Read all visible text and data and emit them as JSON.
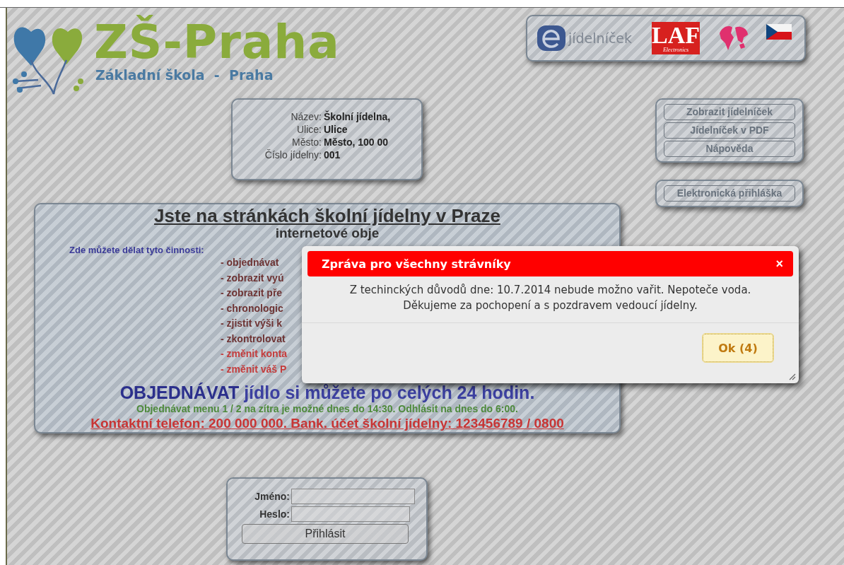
{
  "logo": {
    "title": "ZŠ-Praha",
    "subtitle": "Základní škola  -  Praha"
  },
  "partners": {
    "ejidelnicek": "jídelníček",
    "laf": "LAF",
    "laf_sub": "Electronics"
  },
  "canteen_info": [
    {
      "label": "Název:",
      "value": "Školní jídelna,"
    },
    {
      "label": "Ulice:",
      "value": "Ulice"
    },
    {
      "label": "Město:",
      "value": "Město, 100 00"
    },
    {
      "label": "Číslo jídelny:",
      "value": "001"
    }
  ],
  "menu_buttons": [
    "Zobrazit jídelníček",
    "Jídelníček v PDF",
    "Nápověda"
  ],
  "registration_button": "Elektronická přihláška",
  "welcome": {
    "title": "Jste na stránkách školní jídelny v Praze",
    "subtitle": "internetové obje",
    "intro": "Zde můžete dělat tyto činnosti:",
    "activities": [
      {
        "text": "- objednávat",
        "color": "#6e3434"
      },
      {
        "text": "- zobrazit vyú",
        "color": "#6e3434"
      },
      {
        "text": "- zobrazit pře",
        "color": "#6e3434"
      },
      {
        "text": "- chronologic",
        "color": "#6e3434"
      },
      {
        "text": "- zjistit výši k",
        "color": "#6e3434"
      },
      {
        "text": "- zkontrolovat",
        "color": "#6e3434"
      },
      {
        "text": "- změnit konta",
        "color": "#c43c3c"
      },
      {
        "text": "- změnit váš P",
        "color": "#c43c3c"
      }
    ],
    "headline": "**OBJEDNÁVAT** jídlo si můžete po celých 24 hodin.",
    "deadline": "Objednávat menu 1 / 2 na zítra je možné dnes do 14:30. Odhlásit na dnes do 6:00.",
    "contact": "Kontaktní telefon: 200 000 000. Bank. účet školní jídelny: 123456789 / 0800"
  },
  "login": {
    "fields": [
      {
        "label": "Jméno:"
      },
      {
        "label": "Heslo:"
      }
    ],
    "button": "Přihlásit"
  },
  "dialog": {
    "title": "Zpráva pro všechny strávníky",
    "close": "×",
    "message": "Z techinckých důvodů dne: 10.7.2014 nebude možno vařit. Nepoteče voda. Děkujeme za pochopení a s pozdravem vedoucí jídelny.",
    "button": "Ok (4)"
  }
}
